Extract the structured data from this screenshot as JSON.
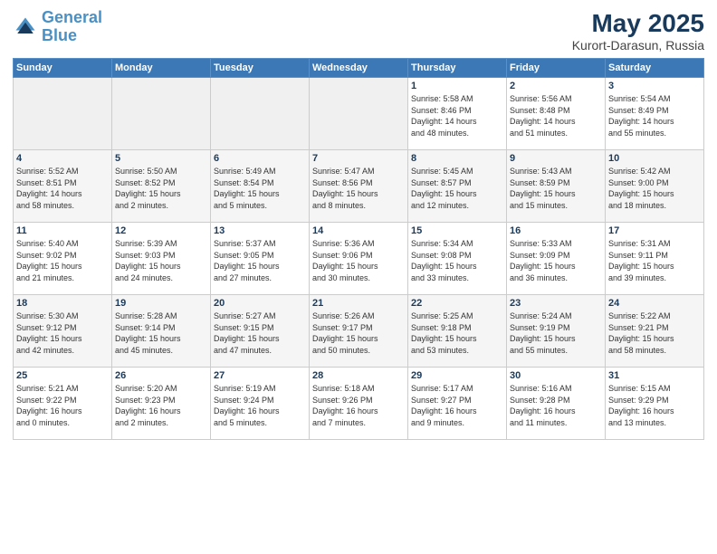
{
  "header": {
    "logo_line1": "General",
    "logo_line2": "Blue",
    "title": "May 2025",
    "subtitle": "Kurort-Darasun, Russia"
  },
  "weekdays": [
    "Sunday",
    "Monday",
    "Tuesday",
    "Wednesday",
    "Thursday",
    "Friday",
    "Saturday"
  ],
  "weeks": [
    [
      {
        "day": "",
        "info": ""
      },
      {
        "day": "",
        "info": ""
      },
      {
        "day": "",
        "info": ""
      },
      {
        "day": "",
        "info": ""
      },
      {
        "day": "1",
        "info": "Sunrise: 5:58 AM\nSunset: 8:46 PM\nDaylight: 14 hours\nand 48 minutes."
      },
      {
        "day": "2",
        "info": "Sunrise: 5:56 AM\nSunset: 8:48 PM\nDaylight: 14 hours\nand 51 minutes."
      },
      {
        "day": "3",
        "info": "Sunrise: 5:54 AM\nSunset: 8:49 PM\nDaylight: 14 hours\nand 55 minutes."
      }
    ],
    [
      {
        "day": "4",
        "info": "Sunrise: 5:52 AM\nSunset: 8:51 PM\nDaylight: 14 hours\nand 58 minutes."
      },
      {
        "day": "5",
        "info": "Sunrise: 5:50 AM\nSunset: 8:52 PM\nDaylight: 15 hours\nand 2 minutes."
      },
      {
        "day": "6",
        "info": "Sunrise: 5:49 AM\nSunset: 8:54 PM\nDaylight: 15 hours\nand 5 minutes."
      },
      {
        "day": "7",
        "info": "Sunrise: 5:47 AM\nSunset: 8:56 PM\nDaylight: 15 hours\nand 8 minutes."
      },
      {
        "day": "8",
        "info": "Sunrise: 5:45 AM\nSunset: 8:57 PM\nDaylight: 15 hours\nand 12 minutes."
      },
      {
        "day": "9",
        "info": "Sunrise: 5:43 AM\nSunset: 8:59 PM\nDaylight: 15 hours\nand 15 minutes."
      },
      {
        "day": "10",
        "info": "Sunrise: 5:42 AM\nSunset: 9:00 PM\nDaylight: 15 hours\nand 18 minutes."
      }
    ],
    [
      {
        "day": "11",
        "info": "Sunrise: 5:40 AM\nSunset: 9:02 PM\nDaylight: 15 hours\nand 21 minutes."
      },
      {
        "day": "12",
        "info": "Sunrise: 5:39 AM\nSunset: 9:03 PM\nDaylight: 15 hours\nand 24 minutes."
      },
      {
        "day": "13",
        "info": "Sunrise: 5:37 AM\nSunset: 9:05 PM\nDaylight: 15 hours\nand 27 minutes."
      },
      {
        "day": "14",
        "info": "Sunrise: 5:36 AM\nSunset: 9:06 PM\nDaylight: 15 hours\nand 30 minutes."
      },
      {
        "day": "15",
        "info": "Sunrise: 5:34 AM\nSunset: 9:08 PM\nDaylight: 15 hours\nand 33 minutes."
      },
      {
        "day": "16",
        "info": "Sunrise: 5:33 AM\nSunset: 9:09 PM\nDaylight: 15 hours\nand 36 minutes."
      },
      {
        "day": "17",
        "info": "Sunrise: 5:31 AM\nSunset: 9:11 PM\nDaylight: 15 hours\nand 39 minutes."
      }
    ],
    [
      {
        "day": "18",
        "info": "Sunrise: 5:30 AM\nSunset: 9:12 PM\nDaylight: 15 hours\nand 42 minutes."
      },
      {
        "day": "19",
        "info": "Sunrise: 5:28 AM\nSunset: 9:14 PM\nDaylight: 15 hours\nand 45 minutes."
      },
      {
        "day": "20",
        "info": "Sunrise: 5:27 AM\nSunset: 9:15 PM\nDaylight: 15 hours\nand 47 minutes."
      },
      {
        "day": "21",
        "info": "Sunrise: 5:26 AM\nSunset: 9:17 PM\nDaylight: 15 hours\nand 50 minutes."
      },
      {
        "day": "22",
        "info": "Sunrise: 5:25 AM\nSunset: 9:18 PM\nDaylight: 15 hours\nand 53 minutes."
      },
      {
        "day": "23",
        "info": "Sunrise: 5:24 AM\nSunset: 9:19 PM\nDaylight: 15 hours\nand 55 minutes."
      },
      {
        "day": "24",
        "info": "Sunrise: 5:22 AM\nSunset: 9:21 PM\nDaylight: 15 hours\nand 58 minutes."
      }
    ],
    [
      {
        "day": "25",
        "info": "Sunrise: 5:21 AM\nSunset: 9:22 PM\nDaylight: 16 hours\nand 0 minutes."
      },
      {
        "day": "26",
        "info": "Sunrise: 5:20 AM\nSunset: 9:23 PM\nDaylight: 16 hours\nand 2 minutes."
      },
      {
        "day": "27",
        "info": "Sunrise: 5:19 AM\nSunset: 9:24 PM\nDaylight: 16 hours\nand 5 minutes."
      },
      {
        "day": "28",
        "info": "Sunrise: 5:18 AM\nSunset: 9:26 PM\nDaylight: 16 hours\nand 7 minutes."
      },
      {
        "day": "29",
        "info": "Sunrise: 5:17 AM\nSunset: 9:27 PM\nDaylight: 16 hours\nand 9 minutes."
      },
      {
        "day": "30",
        "info": "Sunrise: 5:16 AM\nSunset: 9:28 PM\nDaylight: 16 hours\nand 11 minutes."
      },
      {
        "day": "31",
        "info": "Sunrise: 5:15 AM\nSunset: 9:29 PM\nDaylight: 16 hours\nand 13 minutes."
      }
    ]
  ]
}
